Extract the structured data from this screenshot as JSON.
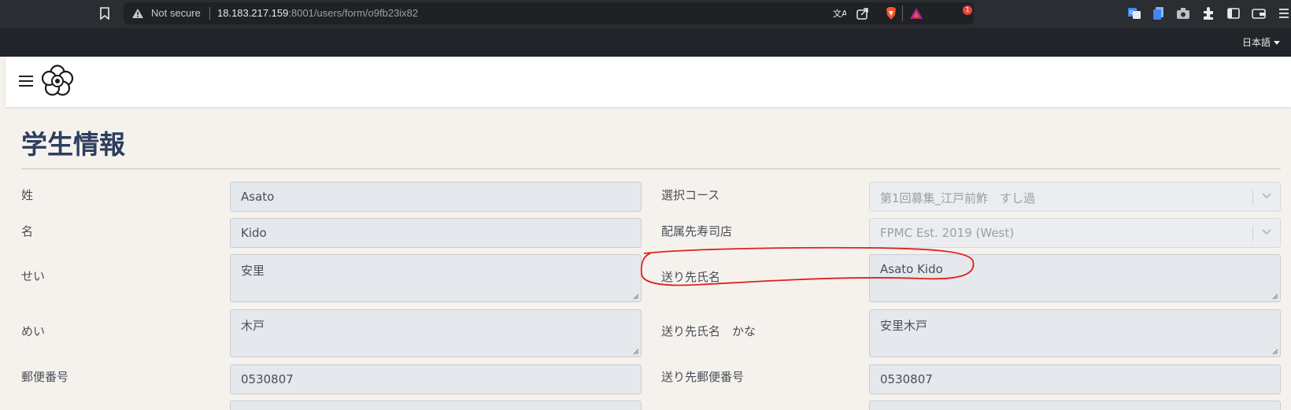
{
  "browser": {
    "not_secure": "Not secure",
    "url_host": "18.183.217.159",
    "url_rest": ":8001/users/form/o9fb23ix82",
    "notification_count": "1",
    "language": "日本語"
  },
  "page": {
    "title": "学生情報"
  },
  "form": {
    "left": [
      {
        "label": "姓",
        "value": "Asato"
      },
      {
        "label": "名",
        "value": "Kido"
      },
      {
        "label": "せい",
        "value": "安里"
      },
      {
        "label": "めい",
        "value": "木戸"
      },
      {
        "label": "郵便番号",
        "value": "0530807"
      }
    ],
    "right": [
      {
        "label": "選択コース",
        "value": "第1回募集_江戸前鮓　すし過"
      },
      {
        "label": "配属先寿司店",
        "value": "FPMC Est. 2019 (West)"
      },
      {
        "label": "送り先氏名",
        "value": "Asato Kido"
      },
      {
        "label": "送り先氏名　かな",
        "value": "安里木戸"
      },
      {
        "label": "送り先郵便番号",
        "value": "0530807"
      }
    ]
  },
  "colors": {
    "title": "#2d3e5e",
    "annotation": "#e0201c",
    "page_bg": "#f5f2ee"
  },
  "icons": [
    "bookmark-icon",
    "warning-icon",
    "translate-icon",
    "share-icon",
    "brave-shield-icon",
    "brave-rewards-icon",
    "google-translate-ext-icon",
    "docs-ext-icon",
    "camera-ext-icon",
    "puzzle-extensions-icon",
    "sidebar-icon",
    "wallet-icon",
    "menu-icon",
    "hamburger-icon",
    "logo-icon",
    "chevron-down-icon"
  ]
}
